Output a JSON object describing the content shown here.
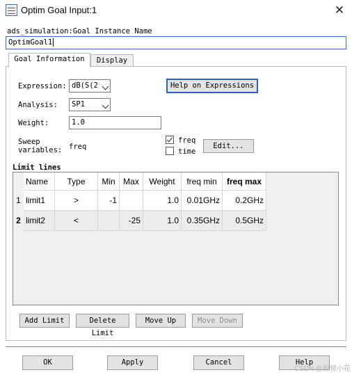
{
  "window": {
    "title": "Optim Goal Input:1",
    "close_glyph": "✕"
  },
  "instance": {
    "label": "ads_simulation:Goal Instance Name",
    "value": "OptimGoal1"
  },
  "tabs": [
    {
      "label": "Goal Information",
      "active": true
    },
    {
      "label": "Display",
      "active": false
    }
  ],
  "goal": {
    "expression_label": "Expression:",
    "expression_value": "dB(S(2",
    "help_button": "Help on Expressions",
    "analysis_label": "Analysis:",
    "analysis_value": "SP1",
    "weight_label": "Weight:",
    "weight_value": "1.0",
    "sweep_label_1": "Sweep",
    "sweep_label_2": "variables:",
    "sweep_value": "freq",
    "sweep_options": [
      {
        "label": "freq",
        "checked": true
      },
      {
        "label": "time",
        "checked": false
      }
    ],
    "edit_button": "Edit..."
  },
  "limits": {
    "title": "Limit lines",
    "columns": [
      "Name",
      "Type",
      "Min",
      "Max",
      "Weight",
      "freq min",
      "freq max"
    ],
    "rows": [
      {
        "index": "1",
        "cells": [
          "limit1",
          ">",
          "-1",
          "",
          "1.0",
          "0.01GHz",
          "0.2GHz"
        ]
      },
      {
        "index": "2",
        "cells": [
          "limit2",
          "<",
          "",
          "-25",
          "1.0",
          "0.35GHz",
          "0.5GHz"
        ]
      }
    ],
    "buttons": {
      "add": "Add Limit",
      "delete": "Delete Limit",
      "move_up": "Move Up",
      "move_down": "Move Down"
    }
  },
  "footer": {
    "ok": "OK",
    "apply": "Apply",
    "cancel": "Cancel",
    "help": "Help",
    "watermark": "CSDN @射频小花"
  },
  "colors": {
    "accent_border": "#2f6fc7",
    "help_button_border": "#2a63b8"
  }
}
